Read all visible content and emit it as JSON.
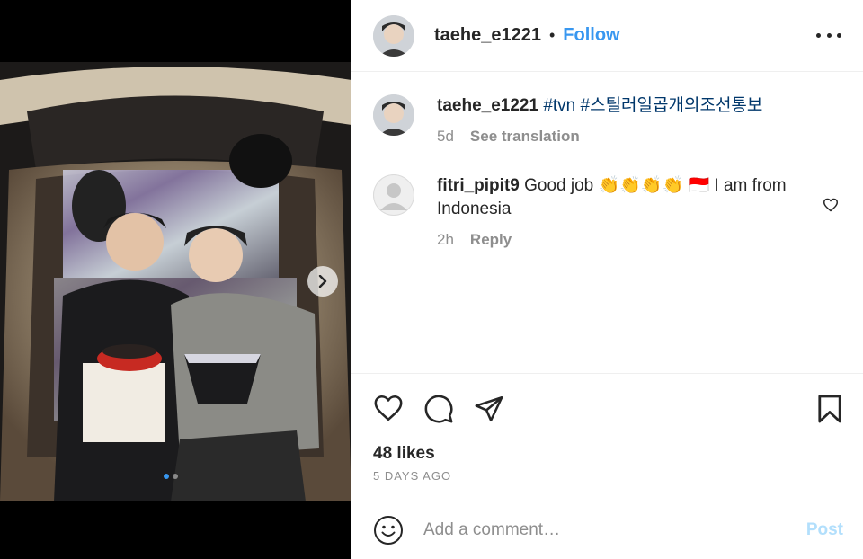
{
  "post": {
    "author": "taehe_e1221",
    "separator": "•",
    "follow_label": "Follow",
    "more_icon": "more-horizontal-icon"
  },
  "media": {
    "next_icon": "chevron-right-icon",
    "slide_count": 2,
    "active_slide": 1
  },
  "comments": [
    {
      "username": "taehe_e1221",
      "text_parts": [
        "#tvn",
        "#스틸러일곱개의조선통보"
      ],
      "age": "5d",
      "action": "See translation"
    },
    {
      "username": "fitri_pipit9",
      "text_before": "Good job",
      "emojis": "👏👏👏👏 🇮🇩",
      "text_after": "I am from Indonesia",
      "age": "2h",
      "action": "Reply",
      "like_icon": "heart-outline-icon"
    }
  ],
  "actions": {
    "like_icon": "heart-outline-icon",
    "comment_icon": "comment-bubble-icon",
    "share_icon": "paper-plane-icon",
    "save_icon": "bookmark-icon",
    "likes": "48 likes",
    "ago": "5 DAYS AGO"
  },
  "composer": {
    "emoji_icon": "smiley-icon",
    "placeholder": "Add a comment…",
    "post_label": "Post"
  },
  "colors": {
    "link_blue": "#3897f0",
    "hashtag": "#00376b",
    "muted": "#8e8e8e",
    "post_disabled": "#b2dffc"
  }
}
